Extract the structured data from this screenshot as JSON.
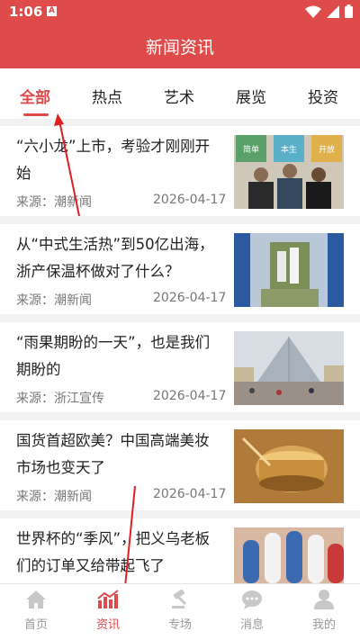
{
  "status_bar": {
    "time": "1:06",
    "sim_label": "A"
  },
  "header": {
    "title": "新闻资讯"
  },
  "tabs": [
    {
      "label": "全部"
    },
    {
      "label": "热点"
    },
    {
      "label": "艺术"
    },
    {
      "label": "展览"
    },
    {
      "label": "投资"
    }
  ],
  "thumb_labels": [
    "简单",
    "本生",
    "开放"
  ],
  "articles": [
    {
      "title": "“六小龙”上市，考验才刚刚开始",
      "source": "来源：潮新闻",
      "date": "2026-04-17"
    },
    {
      "title": "从“中式生活热”到50亿出海，浙产保温杯做对了什么？",
      "source": "来源：潮新闻",
      "date": "2026-04-17"
    },
    {
      "title": "“雨果期盼的一天”，也是我们期盼的",
      "source": "来源：浙江宣传",
      "date": "2026-04-17"
    },
    {
      "title": "国货首超欧美？中国高端美妆市场也变天了",
      "source": "来源：潮新闻",
      "date": "2026-04-17"
    },
    {
      "title": "世界杯的“季风”，把义乌老板们的订单又给带起飞了",
      "source": "",
      "date": ""
    }
  ],
  "bottom_nav": [
    {
      "label": "首页",
      "icon": "home-icon"
    },
    {
      "label": "资讯",
      "icon": "chart-icon"
    },
    {
      "label": "专场",
      "icon": "gavel-icon"
    },
    {
      "label": "消息",
      "icon": "chat-icon"
    },
    {
      "label": "我的",
      "icon": "user-icon"
    }
  ],
  "colors": {
    "accent": "#df4b4b",
    "text": "#222222",
    "muted": "#777777"
  }
}
